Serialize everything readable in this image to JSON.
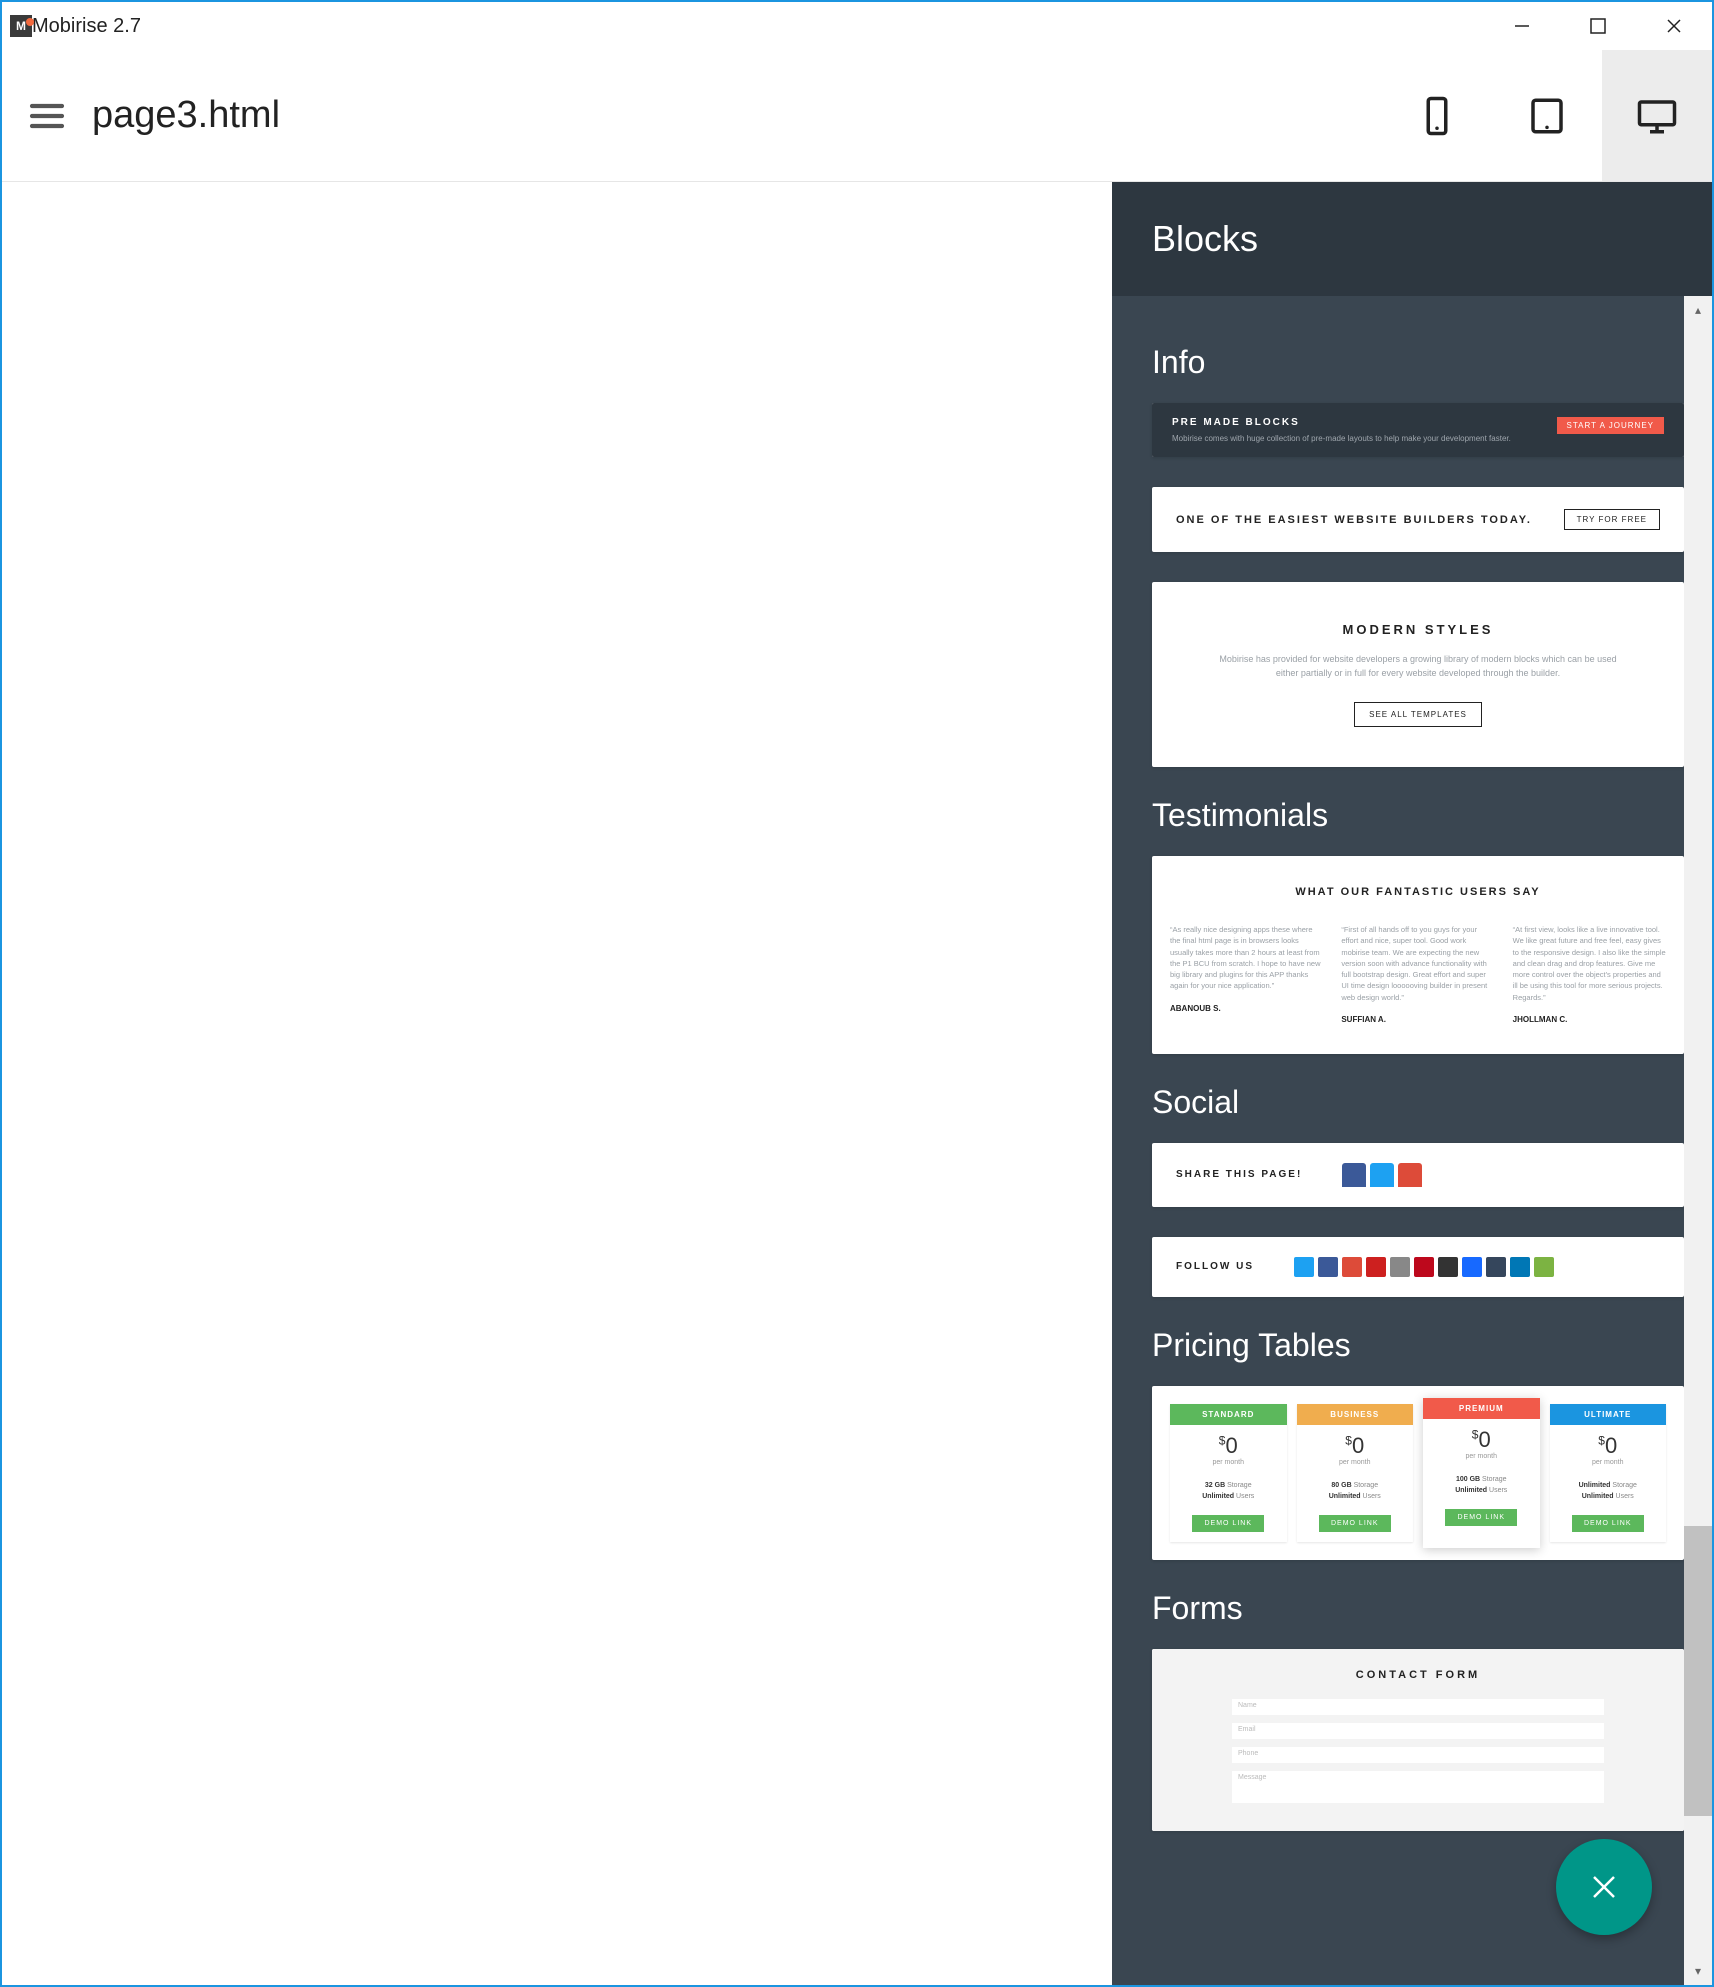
{
  "window": {
    "title": "Mobirise 2.7"
  },
  "topbar": {
    "page": "page3.html"
  },
  "panel": {
    "title": "Blocks"
  },
  "categories": {
    "info": {
      "title": "Info",
      "block1": {
        "heading": "PRE MADE BLOCKS",
        "sub": "Mobirise comes with huge collection of pre-made layouts to help make your development faster.",
        "button": "START A JOURNEY"
      },
      "block2": {
        "heading": "ONE OF THE EASIEST WEBSITE BUILDERS TODAY.",
        "button": "TRY FOR FREE"
      },
      "block3": {
        "heading": "MODERN STYLES",
        "body": "Mobirise has provided for website developers a growing library of modern blocks which can be used either partially or in full for every website developed through the builder.",
        "button": "SEE ALL TEMPLATES"
      }
    },
    "testimonials": {
      "title": "Testimonials",
      "block": {
        "heading": "WHAT OUR FANTASTIC USERS SAY",
        "cols": [
          {
            "quote": "“As really nice designing apps these where the final html page is in browsers looks usually takes more than 2 hours at least from the P1 BCU from scratch. I hope to have new big library and plugins for this APP thanks again for your nice application.”",
            "author": "ABANOUB S."
          },
          {
            "quote": "“First of all hands off to you guys for your effort and nice, super tool. Good work mobirise team. We are expecting the new version soon with advance functionality with full bootstrap design. Great effort and super UI time design loooooving builder in present web design world.”",
            "author": "SUFFIAN A."
          },
          {
            "quote": "“At first view, looks like a live innovative tool. We like great future and free feel, easy gives to the responsive design. I also like the simple and clean drag and drop features. Give me more control over the object's properties and ill be using this tool for more serious projects. Regards.”",
            "author": "JHOLLMAN C."
          }
        ]
      }
    },
    "social": {
      "title": "Social",
      "block1": {
        "label": "SHARE THIS PAGE!"
      },
      "block2": {
        "label": "FOLLOW US"
      }
    },
    "pricing": {
      "title": "Pricing Tables",
      "plans": [
        {
          "name": "STANDARD",
          "color": "#5cb85c",
          "price": "0",
          "per": "per month",
          "f1b": "32 GB",
          "f1": "Storage",
          "f2b": "Unlimited",
          "f2": "Users",
          "btn": "DEMO LINK"
        },
        {
          "name": "BUSINESS",
          "color": "#f0ad4e",
          "price": "0",
          "per": "per month",
          "f1b": "80 GB",
          "f1": "Storage",
          "f2b": "Unlimited",
          "f2": "Users",
          "btn": "DEMO LINK"
        },
        {
          "name": "PREMIUM",
          "color": "#f15a4a",
          "price": "0",
          "per": "per month",
          "f1b": "100 GB",
          "f1": "Storage",
          "f2b": "Unlimited",
          "f2": "Users",
          "btn": "DEMO LINK",
          "featured": true
        },
        {
          "name": "ULTIMATE",
          "color": "#1b95e0",
          "price": "0",
          "per": "per month",
          "f1b": "Unlimited",
          "f1": "Storage",
          "f2b": "Unlimited",
          "f2": "Users",
          "btn": "DEMO LINK"
        }
      ]
    },
    "forms": {
      "title": "Forms",
      "block": {
        "heading": "CONTACT FORM",
        "fields": [
          "Name",
          "Email",
          "Phone",
          "Message"
        ]
      }
    }
  },
  "social_colors": {
    "share": [
      "#3b5998",
      "#1da1f2",
      "#dd4b39"
    ],
    "follow": [
      "#1da1f2",
      "#3b5998",
      "#dd4b39",
      "#cd201f",
      "#888888",
      "#bd081c",
      "#333333",
      "#1769ff",
      "#35465c",
      "#0077b5",
      "#7cb342"
    ]
  }
}
